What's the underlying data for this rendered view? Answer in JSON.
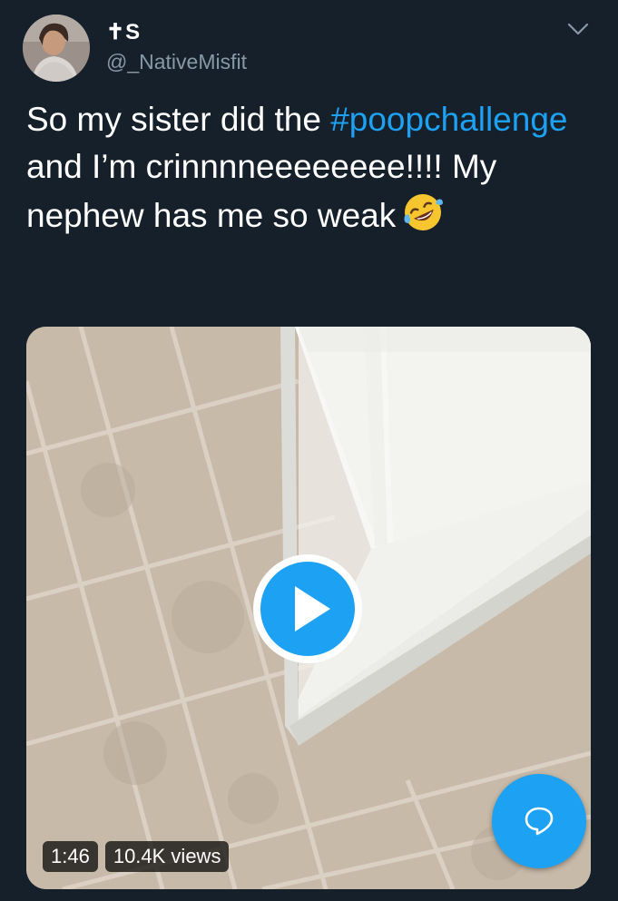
{
  "user": {
    "display_name": "✝S",
    "handle": "@_NativeMisfit"
  },
  "tweet": {
    "text_part1": "So my sister did the ",
    "hashtag": "#poopchallenge",
    "text_part2": " and I’m crinnnneeeeeeee!!!! My nephew has me so weak",
    "emoji": "rolling-on-floor-laughing-emoji"
  },
  "media": {
    "type": "video",
    "duration": "1:46",
    "views": "10.4K views"
  },
  "icons": {
    "caret": "chevron-down-icon",
    "play": "play-icon",
    "compose": "compose-reply-icon"
  },
  "colors": {
    "background": "#15202b",
    "accent": "#1da1f2",
    "secondary_text": "#8899a6"
  }
}
